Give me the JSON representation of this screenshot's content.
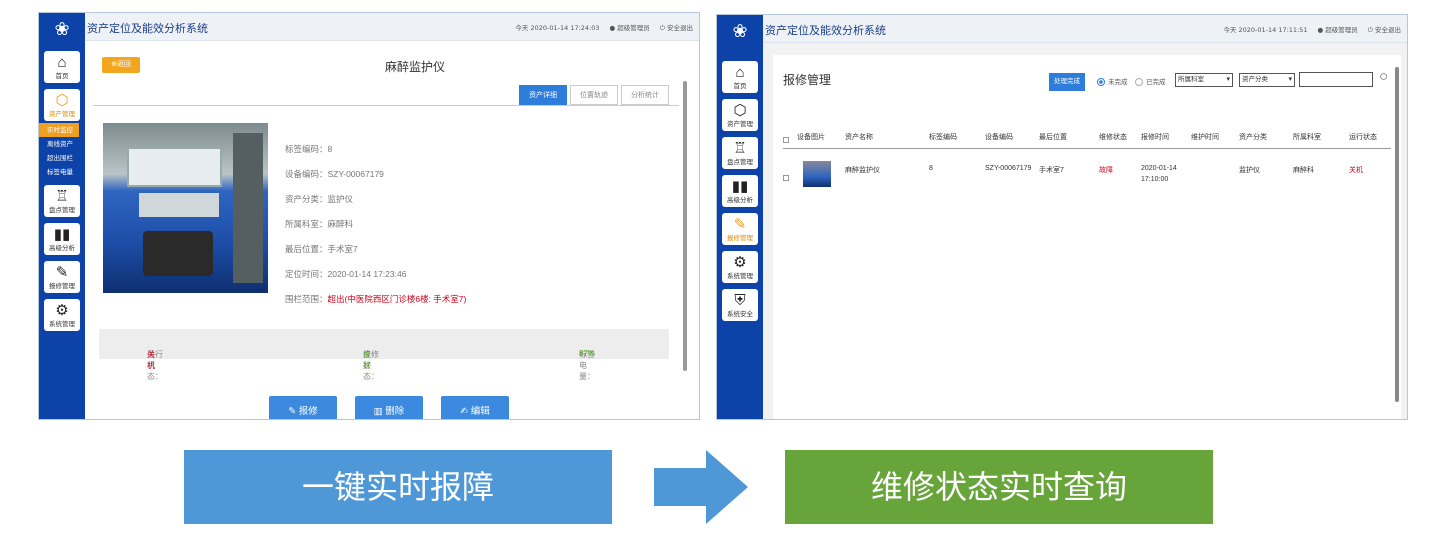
{
  "left_window": {
    "app_title": "资产定位及能效分析系统",
    "header_right": {
      "date": "今天 2020-01-14 17:24:03",
      "user": "超级管理员",
      "logout": "安全退出"
    },
    "sidebar": [
      {
        "icon": "home-icon",
        "label": "首页"
      },
      {
        "icon": "box-icon",
        "label": "资产管理",
        "active": true
      },
      {
        "icon": "clipboard-icon",
        "label": "盘点管理"
      },
      {
        "icon": "bar-chart-icon",
        "label": "高级分析"
      },
      {
        "icon": "wrench-icon",
        "label": "报修管理"
      },
      {
        "icon": "gear-icon",
        "label": "系统管理"
      }
    ],
    "subnav": [
      "实时监控",
      "离线资产",
      "超出围栏",
      "标签电量"
    ],
    "back_label": "返回",
    "detail_title": "麻醉监护仪",
    "tabs": [
      "资产详细",
      "位置轨迹",
      "分析统计"
    ],
    "info": {
      "tag_code": "标签编码：8",
      "device_code": "设备编码：SZY-00067179",
      "category": "资产分类：监护仪",
      "department": "所属科室：麻醉科",
      "last_location": "最后位置：手术室7",
      "locate_time": "定位时间：2020-01-14 17:23:46",
      "fence_label": "围栏范围：",
      "fence_value": "超出(中医院西区门诊楼6楼: 手术室7)"
    },
    "status": {
      "run_label": "运行状态：",
      "run_value": "关机",
      "repair_label": "维修状态：",
      "repair_value": "良好",
      "battery_label": "标签电量：",
      "battery_value": "87%"
    },
    "buttons": {
      "repair": "报修",
      "delete": "删除",
      "edit": "编辑"
    }
  },
  "right_window": {
    "app_title": "资产定位及能效分析系统",
    "header_right": {
      "date": "今天 2020-01-14 17:11:51",
      "user": "超级管理员",
      "logout": "安全退出"
    },
    "sidebar": [
      {
        "icon": "home-icon",
        "label": "首页"
      },
      {
        "icon": "box-icon",
        "label": "资产管理"
      },
      {
        "icon": "clipboard-icon",
        "label": "盘点管理"
      },
      {
        "icon": "bar-chart-icon",
        "label": "高级分析"
      },
      {
        "icon": "wrench-icon",
        "label": "报修管理",
        "active": true
      },
      {
        "icon": "gear-icon",
        "label": "系统管理"
      },
      {
        "icon": "shield-icon",
        "label": "系统安全"
      }
    ],
    "panel_title": "报修管理",
    "done_button": "处理完成",
    "radio_pending": "未完成",
    "radio_done": "已完成",
    "select_department": "所属科室",
    "select_category": "资产分类",
    "columns": [
      "设备图片",
      "资产名称",
      "标签编码",
      "设备编码",
      "最后位置",
      "维修状态",
      "报修时间",
      "维护时间",
      "资产分类",
      "所属科室",
      "运行状态"
    ],
    "row": {
      "name": "麻醉监护仪",
      "tag": "8",
      "code": "SZY-00067179",
      "location": "手术室7",
      "repair_status": "故障",
      "report_date": "2020-01-14",
      "report_time": "17:10:00",
      "maint_time": "",
      "category": "监护仪",
      "department": "麻醉科",
      "run_status": "关机"
    }
  },
  "banners": {
    "left": "一键实时报障",
    "right": "维修状态实时查询"
  },
  "colors": {
    "sidebar": "#0d43a8",
    "accent": "#f0a020",
    "primary_button": "#3b8ae0",
    "banner_left": "#4f98d8",
    "banner_right": "#67a53a",
    "alert": "#d0021b"
  }
}
